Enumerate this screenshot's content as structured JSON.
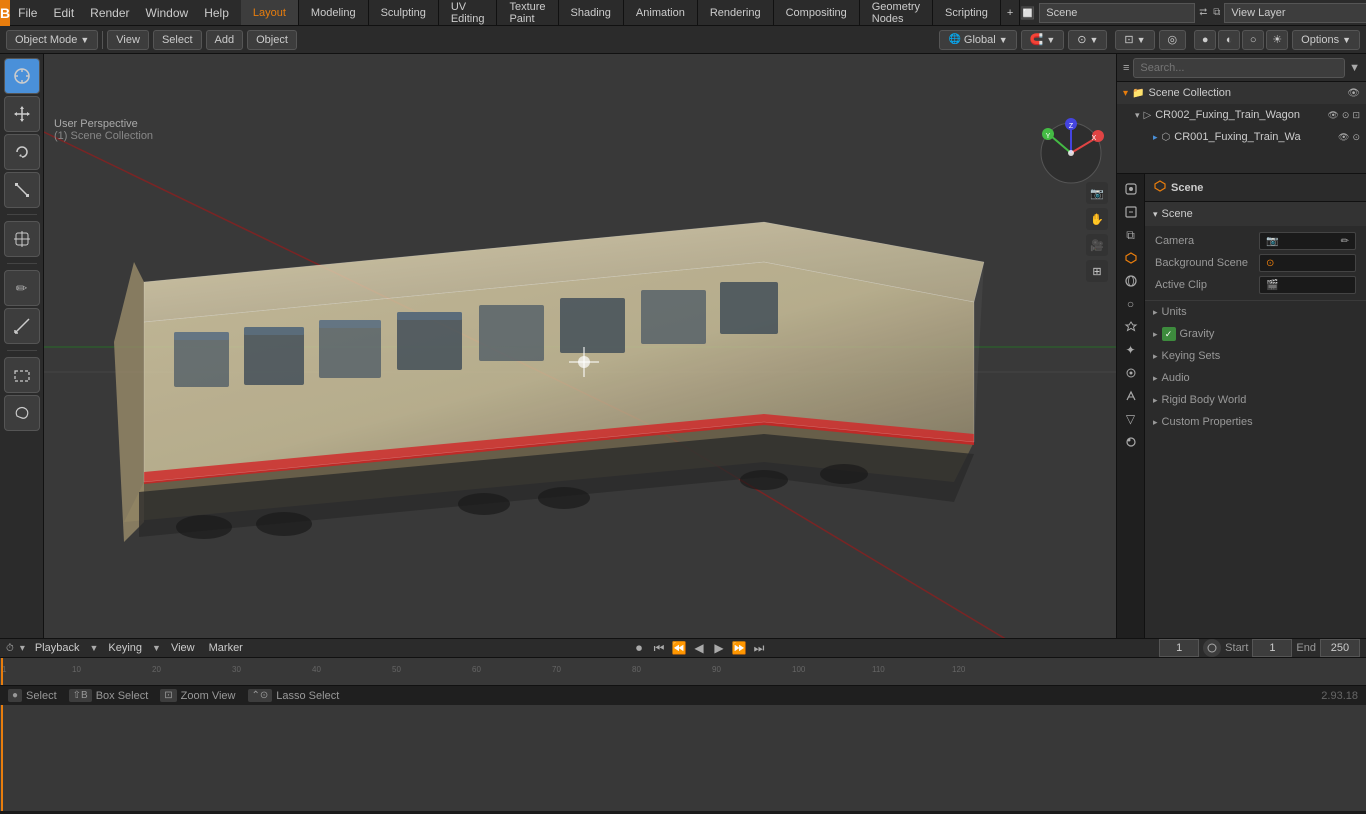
{
  "topbar": {
    "logo": "B",
    "menus": [
      "File",
      "Edit",
      "Render",
      "Window",
      "Help"
    ],
    "workspaces": [
      "Layout",
      "Modeling",
      "Sculpting",
      "UV Editing",
      "Texture Paint",
      "Shading",
      "Animation",
      "Rendering",
      "Compositing",
      "Geometry Nodes",
      "Scripting"
    ],
    "active_workspace": "Layout",
    "scene_label": "Scene",
    "view_layer_label": "View Layer"
  },
  "viewport": {
    "perspective_label": "User Perspective",
    "collection_label": "(1) Scene Collection",
    "header_buttons": [
      "Object Mode",
      "View",
      "Select",
      "Add",
      "Object"
    ],
    "transform_dropdown": "Global",
    "options_label": "Options"
  },
  "left_tools": [
    {
      "name": "cursor",
      "icon": "⊕"
    },
    {
      "name": "move",
      "icon": "✛"
    },
    {
      "name": "rotate",
      "icon": "↻"
    },
    {
      "name": "scale",
      "icon": "⤡"
    },
    {
      "name": "transform",
      "icon": "⬡"
    },
    {
      "name": "separator1"
    },
    {
      "name": "annotate",
      "icon": "✏"
    },
    {
      "name": "measure",
      "icon": "📐"
    },
    {
      "name": "separator2"
    },
    {
      "name": "add-cube",
      "icon": "□"
    },
    {
      "name": "extrude",
      "icon": "⬆"
    },
    {
      "name": "inset",
      "icon": "◎"
    },
    {
      "name": "bevel",
      "icon": "⌐"
    }
  ],
  "right_props": [
    {
      "name": "render",
      "icon": "📷"
    },
    {
      "name": "output",
      "icon": "🖨"
    },
    {
      "name": "view-layer",
      "icon": "⧉"
    },
    {
      "name": "scene",
      "icon": "🔲",
      "active": true
    },
    {
      "name": "world",
      "icon": "🌍"
    },
    {
      "name": "object",
      "icon": "○"
    },
    {
      "name": "modifier",
      "icon": "🔧"
    },
    {
      "name": "particles",
      "icon": "✦"
    },
    {
      "name": "physics",
      "icon": "⚛"
    },
    {
      "name": "constraints",
      "icon": "🔗"
    },
    {
      "name": "data",
      "icon": "▽"
    }
  ],
  "outliner": {
    "title": "Scene Collection",
    "items": [
      {
        "label": "CR002_Fuxing_Train_Wagon",
        "indent": 0,
        "icon": "▷",
        "expanded": true
      },
      {
        "label": "CR001_Fuxing_Train_Wa",
        "indent": 1,
        "icon": "▸",
        "expanded": false
      }
    ]
  },
  "scene_properties": {
    "title": "Scene",
    "sections": {
      "scene": {
        "label": "Scene",
        "expanded": true,
        "fields": [
          {
            "label": "Camera",
            "value": "",
            "type": "object-ref"
          },
          {
            "label": "Background Scene",
            "value": "",
            "type": "object-ref"
          },
          {
            "label": "Active Clip",
            "value": "",
            "type": "object-ref"
          }
        ]
      },
      "units": {
        "label": "Units",
        "expanded": false
      },
      "gravity": {
        "label": "Gravity",
        "expanded": false,
        "checkbox": true
      },
      "keying_sets": {
        "label": "Keying Sets",
        "expanded": false
      },
      "audio": {
        "label": "Audio",
        "expanded": false
      },
      "rigid_body_world": {
        "label": "Rigid Body World",
        "expanded": false
      },
      "custom_properties": {
        "label": "Custom Properties",
        "expanded": false
      }
    }
  },
  "timeline": {
    "playback_label": "Playback",
    "keying_label": "Keying",
    "view_label": "View",
    "marker_label": "Marker",
    "frame_current": "1",
    "start_label": "Start",
    "start_value": "1",
    "end_label": "End",
    "end_value": "250",
    "controls": [
      "⏮",
      "⏪",
      "◀",
      "▶",
      "⏩",
      "⏭"
    ]
  },
  "statusbar": {
    "select_label": "Select",
    "box_select_label": "Box Select",
    "zoom_label": "Zoom View",
    "lasso_label": "Lasso Select",
    "version": "2.93.18"
  },
  "colors": {
    "accent": "#e87d0d",
    "active_tab": "#3d3d3d",
    "selected_bg": "#234f7d",
    "panel_bg": "#2b2b2b",
    "viewport_bg": "#393939",
    "checkbox_green": "#3d8b3d"
  }
}
